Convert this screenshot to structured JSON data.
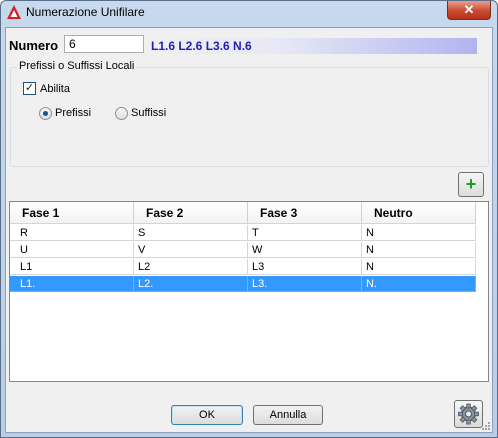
{
  "window": {
    "title": "Numerazione Unifilare",
    "close_label": "✕"
  },
  "numero": {
    "label": "Numero",
    "value": "6",
    "preview": "L1.6 L2.6 L3.6 N.6"
  },
  "locali": {
    "title": "Prefissi o Suffissi Locali",
    "abilita_label": "Abilita",
    "abilita_checked": true,
    "prefissi_label": "Prefissi",
    "suffissi_label": "Suffissi",
    "selected": "Prefissi"
  },
  "grid": {
    "columns": [
      "Fase 1",
      "Fase 2",
      "Fase 3",
      "Neutro"
    ],
    "rows": [
      [
        "R",
        "S",
        "T",
        "N"
      ],
      [
        "U",
        "V",
        "W",
        "N"
      ],
      [
        "L1",
        "L2",
        "L3",
        "N"
      ],
      [
        "L1.",
        "L2.",
        "L3.",
        "N."
      ]
    ],
    "selected_row": 3
  },
  "buttons": {
    "add": "+",
    "ok": "OK",
    "cancel": "Annulla"
  },
  "colors": {
    "selection": "#3399ff",
    "preview_text": "#2020b8"
  }
}
